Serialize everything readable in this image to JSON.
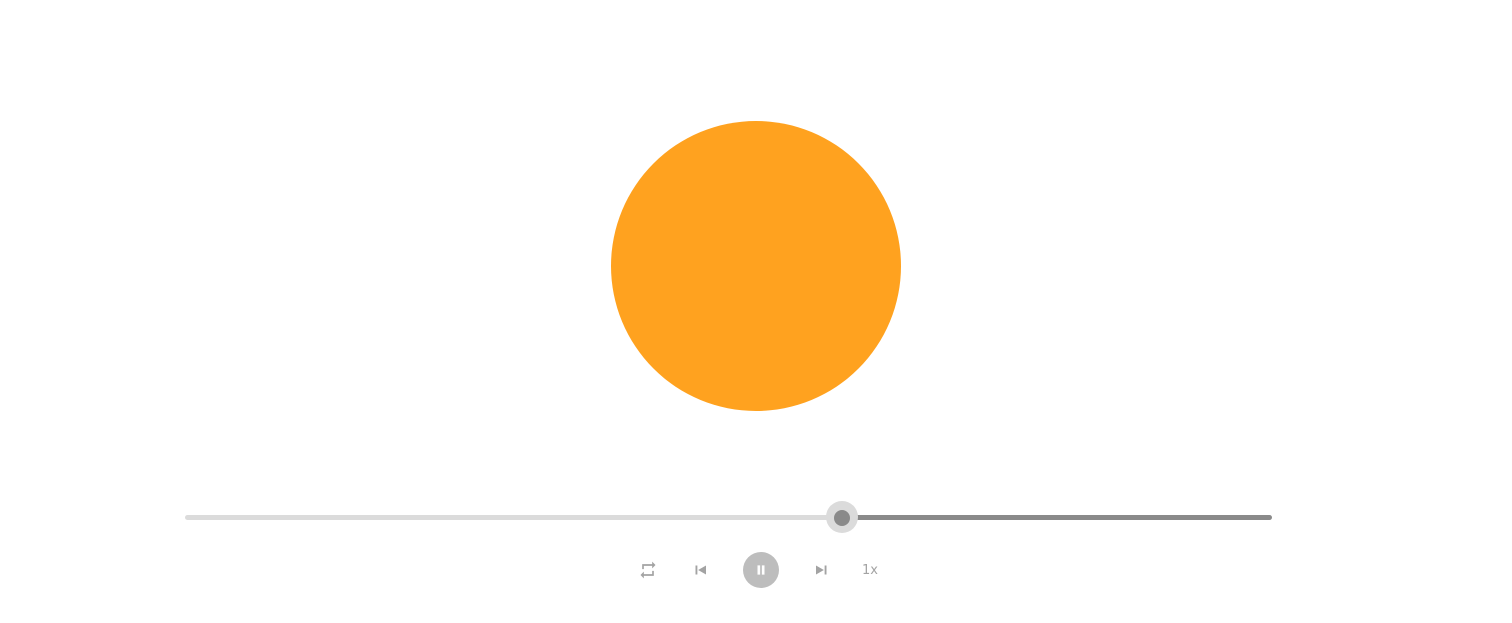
{
  "colors": {
    "accent": "#FFA21F",
    "track_played": "#DBDBDB",
    "track_remaining": "#8A8A8A",
    "thumb": "#8A8A8A",
    "thumb_halo": "#DBDBDB",
    "icon": "#A3A3A3",
    "play_button_bg": "#BDBDBD",
    "play_button_icon": "#FFFFFF"
  },
  "player": {
    "progress": 0.604,
    "controls": {
      "repeat_icon": "repeat-icon",
      "prev_icon": "skip-previous-icon",
      "play_pause_icon": "pause-icon",
      "next_icon": "skip-next-icon",
      "speed_label": "1x"
    }
  }
}
